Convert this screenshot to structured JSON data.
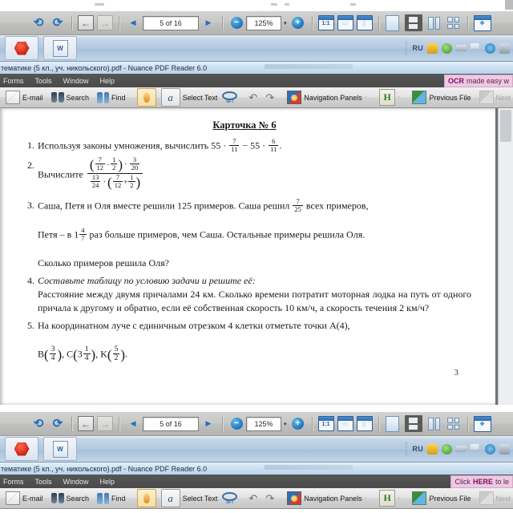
{
  "viewer_toolbar": {
    "rotate_ccw": "rotate-counterclockwise",
    "rotate_cw": "rotate-clockwise",
    "back": "←",
    "forward": "→",
    "prev_page": "◀",
    "page_field": "5 of 16",
    "next_page": "▶",
    "zoom_out": "−",
    "zoom_value": "125%",
    "zoom_caret": "▾",
    "zoom_in": "+",
    "actual_size": "1:1",
    "fit_width": "fit-width",
    "fit_page": "fit-page",
    "single_page": "single-page",
    "continuous": "continuous",
    "two_up": "two-up",
    "four_up": "four-up",
    "full_screen": "full-screen"
  },
  "taskbar": {
    "app1": "red-hexagon-app",
    "app2": "word-document-app",
    "language": "RU",
    "tray": [
      "security-shield-icon",
      "antivirus-icon",
      "battery-icon",
      "flag-icon",
      "network-icon",
      "volume-icon"
    ]
  },
  "window": {
    "title": "тематике (5 кл., уч. никольского).pdf - Nuance PDF Reader 6.0"
  },
  "menubar": {
    "items": [
      "Forms",
      "Tools",
      "Window",
      "Help"
    ],
    "promo_top": "OCR made easy w",
    "promo_bottom": "Click HERE to le",
    "promo_top_bold": "OCR",
    "promo_bottom_bold": "HERE"
  },
  "apptoolbar": {
    "email": "E-mail",
    "search": "Search",
    "find": "Find",
    "select_text": "Select Text",
    "sft": "SFT",
    "undo": "↶",
    "redo": "↷",
    "navigation_panels": "Navigation Panels",
    "nav_caret": "·",
    "highlight": "H",
    "highlight_caret": "·",
    "previous_file": "Previous File",
    "next_file": "Next File"
  },
  "document": {
    "title": "Карточка № 6",
    "page_number": "3",
    "items": [
      {
        "num": "1.",
        "text_before": "Используя законы умножения, вычислить 55 ·",
        "frac1": {
          "n": "7",
          "d": "11"
        },
        "mid": "− 55 ·",
        "frac2": {
          "n": "6",
          "d": "11"
        },
        "text_after": "."
      },
      {
        "num": "2.",
        "label": "Вычислите",
        "complex_fraction": {
          "numerator": "(7/12 − 1/2)·3/20",
          "denominator": "13/24·(7/12 + 1/2)",
          "num_a": {
            "n": "7",
            "d": "12"
          },
          "num_b": {
            "n": "1",
            "d": "2"
          },
          "num_c": {
            "n": "3",
            "d": "20"
          },
          "den_a": {
            "n": "13",
            "d": "24"
          },
          "den_b": {
            "n": "7",
            "d": "12"
          },
          "den_c": {
            "n": "1",
            "d": "2"
          }
        }
      },
      {
        "num": "3.",
        "line1a": "Саша, Петя и Оля вместе решили 125 примеров. Саша решил",
        "frac_a": {
          "n": "7",
          "d": "25"
        },
        "line1b": "всех примеров,",
        "line2a": "Петя – в 1",
        "frac_b": {
          "n": "4",
          "d": "7"
        },
        "line2b": "раз больше примеров, чем Саша. Остальные примеры решила Оля.",
        "line3": "Сколько примеров решила Оля?"
      },
      {
        "num": "4.",
        "italic_line": "Составьте таблицу по условию задачи и решите её:",
        "body": "Расстояние между двумя причалами 24 км. Сколько времени потратит моторная лодка на путь от одного причала к другому и обратно, если её собственная скорость 10 км/ч, а скорость течения 2 км/ч?"
      },
      {
        "num": "5.",
        "line1": "На координатном луче с единичным отрезком 4 клетки отметьте точки A(4),",
        "pt_b": "B",
        "frac_b": {
          "n": "3",
          "d": "4"
        },
        "pt_c": "C",
        "c_whole": "3",
        "frac_c": {
          "n": "1",
          "d": "4"
        },
        "pt_k": "K",
        "frac_k": {
          "n": "5",
          "d": "2"
        },
        "tail": "."
      }
    ]
  },
  "colors": {
    "accent_blue": "#1d74bb",
    "promo_pink": "#edc9e3",
    "menubar_dark": "#4a4a4a",
    "doc_bg": "#ffffff",
    "viewer_gray": "#c9c9c7"
  }
}
